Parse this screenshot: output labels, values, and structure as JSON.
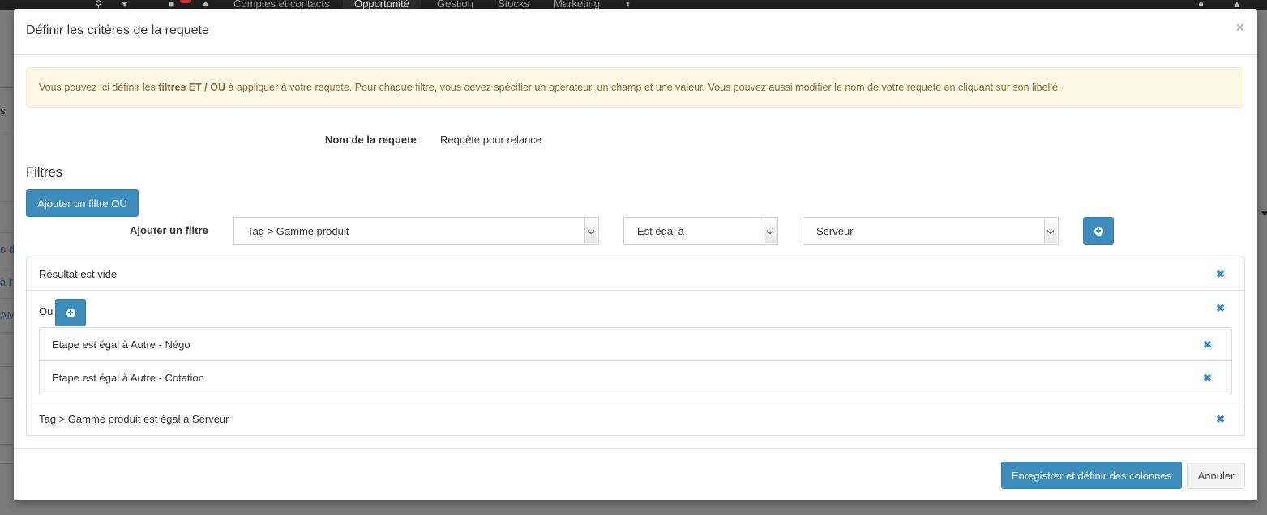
{
  "background": {
    "nav": [
      "Comptes et contacts",
      "Opportunité",
      "Gestion",
      "Stocks",
      "Marketing"
    ],
    "active_nav": "Opportunité",
    "left_fragments": [
      "s",
      "o de",
      "à l'",
      "AM"
    ]
  },
  "modal": {
    "title": "Définir les critères de la requete",
    "close": "×"
  },
  "alert": {
    "before": "Vous pouvez ici définir les ",
    "strong": "filtres ET / OU",
    "after": " à appliquer à votre requete. Pour chaque filtre, vous devez spécifier un opérateur, un champ et une valeur. Vous pouvez aussi modifier le nom de votre requete en cliquant sur son libellé."
  },
  "query": {
    "name_label": "Nom de la requete",
    "name_value": "Requête pour relance"
  },
  "filters": {
    "title": "Filtres",
    "add_or_button": "Ajouter un filtre OU",
    "add_label": "Ajouter un filtre",
    "field_select": "Tag > Gamme produit",
    "operator_select": "Est égal à",
    "value_select": "Serveur"
  },
  "filter_list": {
    "row1": "Résultat est vide",
    "or_label": "Ou",
    "or_items": [
      "Etape est égal à Autre - Négo",
      "Etape est égal à Autre - Cotation"
    ],
    "row3": "Tag > Gamme produit est égal à Serveur",
    "remove_glyph": "✖"
  },
  "footer": {
    "save": "Enregistrer et définir des colonnes",
    "cancel": "Annuler"
  },
  "colors": {
    "primary": "#3c8dbc",
    "alert_bg": "#fcf8e3",
    "alert_text": "#8a6d3b"
  }
}
